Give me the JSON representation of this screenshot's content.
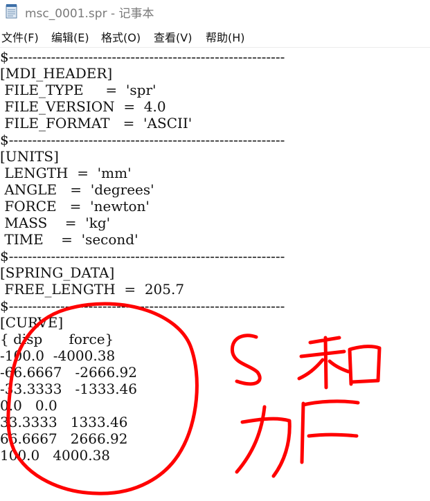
{
  "window": {
    "title": "msc_0001.spr - 记事本"
  },
  "menu": {
    "items": [
      {
        "label": "文件(F)"
      },
      {
        "label": "编辑(E)"
      },
      {
        "label": "格式(O)"
      },
      {
        "label": "查看(V)"
      },
      {
        "label": "帮助(H)"
      }
    ]
  },
  "document": {
    "lines": [
      "$-----------------------------------------------------------",
      "[MDI_HEADER]",
      " FILE_TYPE     =  'spr'",
      " FILE_VERSION  =  4.0",
      " FILE_FORMAT   =  'ASCII'",
      "$-----------------------------------------------------------",
      "[UNITS]",
      " LENGTH  =  'mm'",
      " ANGLE   =  'degrees'",
      " FORCE   =  'newton'",
      " MASS    =  'kg'",
      " TIME    =  'second'",
      "$-----------------------------------------------------------",
      "[SPRING_DATA]",
      " FREE_LENGTH  =  205.7",
      "$-----------------------------------------------------------",
      "[CURVE]",
      "{ disp      force}",
      "-100.0  -4000.38",
      "-66.6667   -2666.92",
      "-33.3333   -1333.46",
      "0.0   0.0",
      "33.3333   1333.46",
      "66.6667   2666.92",
      "100.0   4000.38"
    ]
  },
  "annotation": {
    "color": "#ff0000",
    "handwritten_text": "S和力F"
  }
}
